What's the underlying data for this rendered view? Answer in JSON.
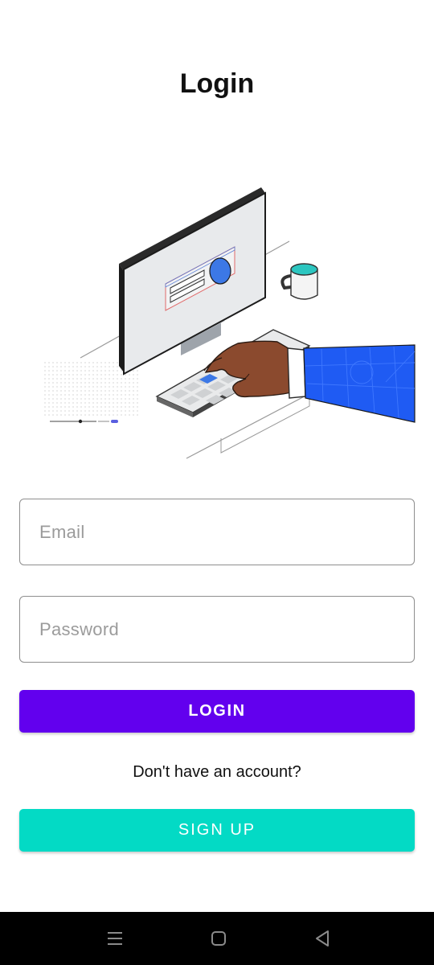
{
  "header": {
    "title": "Login"
  },
  "illustration": {
    "description_icon": "computer-login-illustration-icon"
  },
  "form": {
    "email": {
      "value": "",
      "placeholder": "Email"
    },
    "password": {
      "value": "",
      "placeholder": "Password"
    },
    "login_label": "LOGIN",
    "account_prompt": "Don't have an account?",
    "signup_label": "SIGN UP"
  },
  "nav_bar": {
    "items": [
      {
        "icon": "menu-icon"
      },
      {
        "icon": "home-icon"
      },
      {
        "icon": "back-icon"
      }
    ]
  },
  "colors": {
    "primary": "#6200ee",
    "secondary": "#03dac5",
    "illustration_blue": "#1f5bf3",
    "skin": "#8b4a2e"
  }
}
